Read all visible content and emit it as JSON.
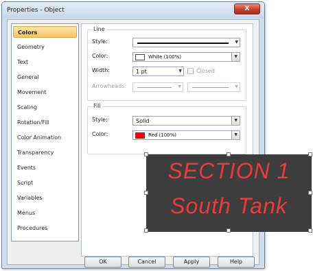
{
  "window": {
    "title": "Properties - Object",
    "close_label": "X"
  },
  "tabs": [
    {
      "label": "Colors",
      "selected": true
    },
    {
      "label": "Geometry"
    },
    {
      "label": "Text"
    },
    {
      "label": "General"
    },
    {
      "label": "Movement"
    },
    {
      "label": "Scaling"
    },
    {
      "label": "Rotation/Fill"
    },
    {
      "label": "Color Animation"
    },
    {
      "label": "Transparency"
    },
    {
      "label": "Events"
    },
    {
      "label": "Script"
    },
    {
      "label": "Variables"
    },
    {
      "label": "Menus"
    },
    {
      "label": "Procedures"
    }
  ],
  "line_group": {
    "title": "Line",
    "style_label": "Style:",
    "color_label": "Color:",
    "color_value": "White (100%)",
    "color_hex": "#ffffff",
    "width_label": "Width:",
    "width_value": "1 pt",
    "closed_label": "Closed",
    "arrowheads_label": "Arrowheads:"
  },
  "fill_group": {
    "title": "Fill",
    "style_label": "Style:",
    "style_value": "Solid",
    "color_label": "Color:",
    "color_value": "Red (100%)",
    "color_hex": "#ff0000"
  },
  "buttons": {
    "ok": "OK",
    "cancel": "Cancel",
    "apply": "Apply",
    "help": "Help"
  },
  "overlay": {
    "line1": "SECTION 1",
    "line2": "South Tank",
    "text_color": "#f03a3a",
    "background": "#3d3d3d"
  }
}
